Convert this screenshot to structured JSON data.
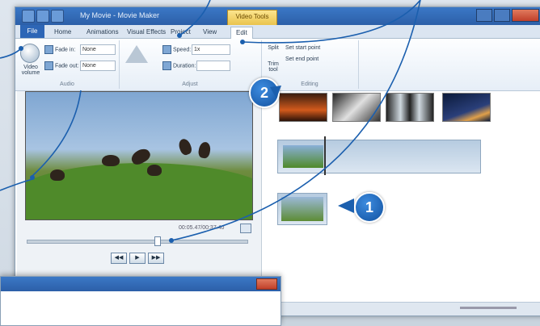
{
  "window": {
    "title": "My Movie - Movie Maker"
  },
  "contextual_tab": {
    "label": "Video Tools"
  },
  "tabs": [
    {
      "label": "Home"
    },
    {
      "label": "Animations"
    },
    {
      "label": "Visual Effects"
    },
    {
      "label": "Project"
    },
    {
      "label": "View"
    },
    {
      "label": "Edit"
    }
  ],
  "file_tab": {
    "label": "File"
  },
  "ribbon": {
    "video_volume": {
      "label": "Video volume"
    },
    "fade_in": {
      "label": "Fade in:",
      "value": "None"
    },
    "fade_out": {
      "label": "Fade out:",
      "value": "None"
    },
    "speed": {
      "label": "Speed:",
      "value": "1x"
    },
    "duration": {
      "label": "Duration:"
    },
    "set_start": {
      "label": "Set start point"
    },
    "set_end": {
      "label": "Set end point"
    },
    "trim_tool": {
      "label": "Trim tool"
    },
    "split": {
      "label": "Split"
    },
    "group_audio": {
      "label": "Audio"
    },
    "group_adjust": {
      "label": "Adjust"
    },
    "group_editing": {
      "label": "Editing"
    }
  },
  "preview": {
    "time": "00:05.47/00:37.40"
  },
  "callouts": {
    "one": "1",
    "two": "2"
  },
  "colors": {
    "accent": "#2c5fa8",
    "callout": "#1a62b6",
    "context": "#e9c24a"
  },
  "icons": {
    "play": "▶",
    "prev": "◀◀",
    "next": "▶▶"
  }
}
